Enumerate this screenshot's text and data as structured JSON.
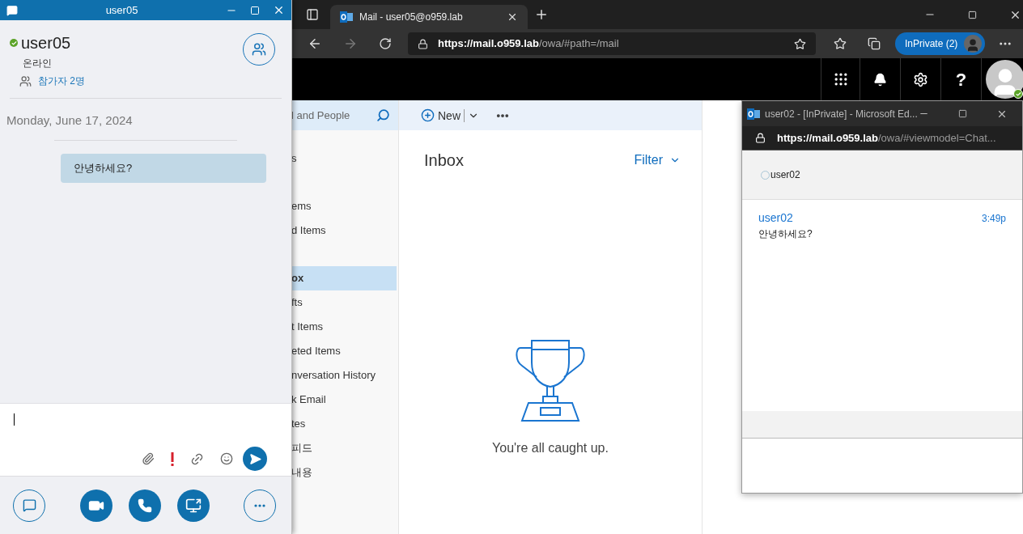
{
  "browser": {
    "tab": {
      "title": "Mail - user05@o959.lab"
    },
    "url": {
      "host": "https://mail.o959.lab",
      "path": "/owa/#path=/mail"
    },
    "inprivate": "InPrivate (2)"
  },
  "owa": {
    "help": "?",
    "search": {
      "placeholder": "l and People"
    },
    "folder_groups": [
      {
        "folders": [
          {
            "label": "s",
            "selected": false
          }
        ]
      },
      {
        "folders": [
          {
            "label": "ems",
            "selected": false
          },
          {
            "label": "d Items",
            "selected": false
          }
        ]
      },
      {
        "folders": [
          {
            "label": "ox",
            "selected": true
          },
          {
            "label": "fts",
            "selected": false
          },
          {
            "label": "t Items",
            "selected": false
          },
          {
            "label": "eted Items",
            "selected": false
          },
          {
            "label": "nversation History",
            "selected": false
          },
          {
            "label": "k Email",
            "selected": false
          },
          {
            "label": "tes",
            "selected": false
          },
          {
            "label": "피드",
            "selected": false
          },
          {
            "label": "내용",
            "selected": false
          }
        ]
      }
    ],
    "new_button": "New",
    "list_title": "Inbox",
    "filter": "Filter",
    "empty_message": "You're all caught up."
  },
  "chat_window": {
    "title": "user05",
    "contact": {
      "name": "user05",
      "available": true,
      "status": "온라인",
      "participants": "참가자 2명"
    },
    "date": "Monday, June 17, 2024",
    "messages": [
      {
        "text": "안녕하세요?"
      }
    ]
  },
  "popup_window": {
    "title": "user02 - [InPrivate] - Microsoft Ed...",
    "url": {
      "host": "https://mail.o959.lab",
      "path": "/owa/#viewmodel=Chat..."
    },
    "contact": {
      "name": "user02",
      "available": false
    },
    "messages": [
      {
        "sender": "user02",
        "time": "3:49p",
        "text": "안녕하세요?"
      }
    ]
  }
}
